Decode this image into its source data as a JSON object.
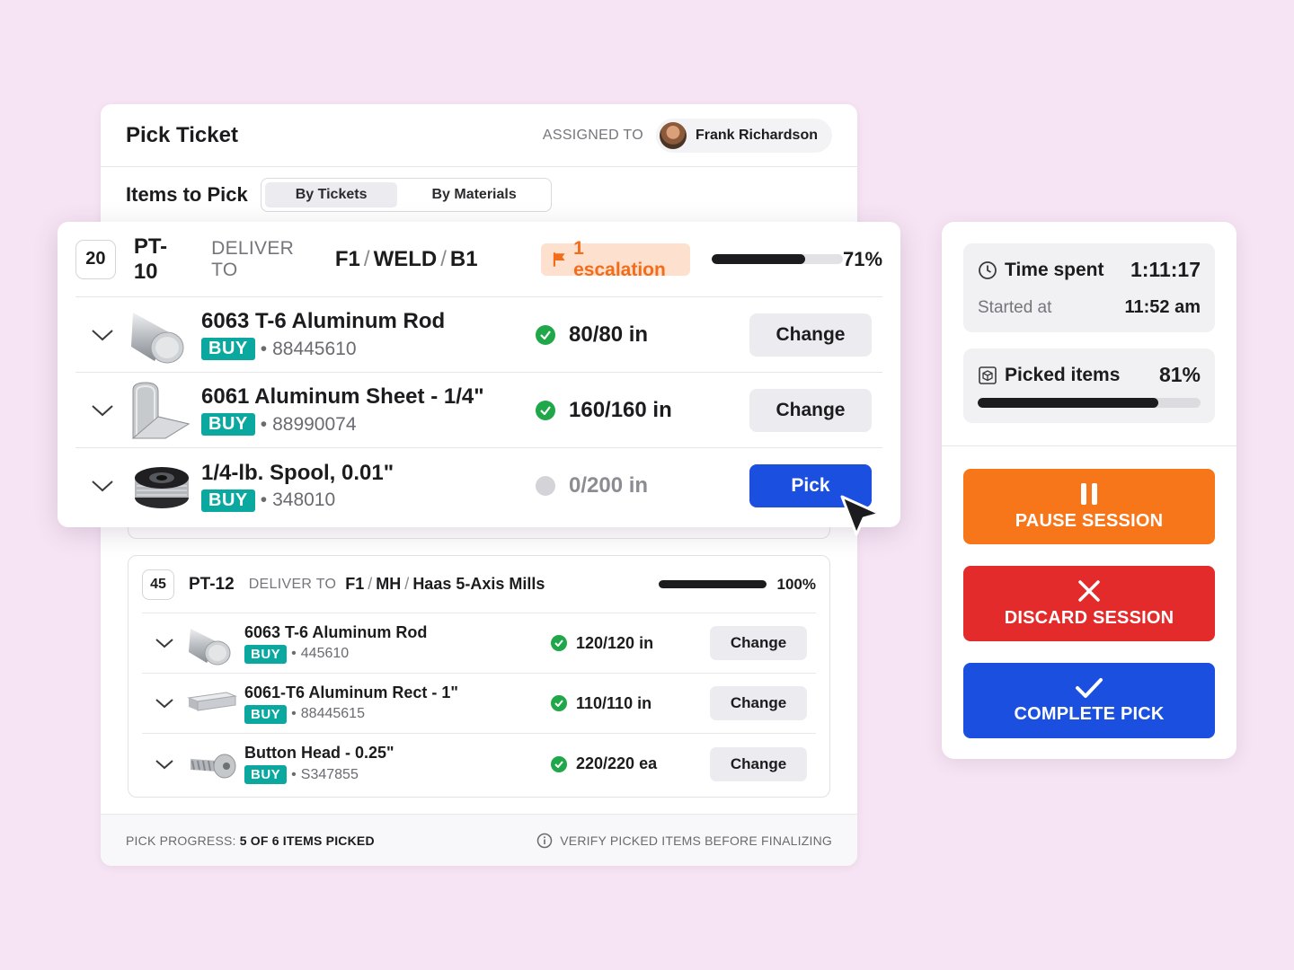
{
  "header": {
    "title": "Pick Ticket",
    "assigned_label": "ASSIGNED TO",
    "assignee": "Frank Richardson"
  },
  "subheader": {
    "title": "Items to Pick",
    "tabs": [
      {
        "label": "By Tickets",
        "active": true
      },
      {
        "label": "By Materials",
        "active": false
      }
    ]
  },
  "tickets": [
    {
      "count": "20",
      "code": "PT-10",
      "deliver_label": "DELIVER TO",
      "location": [
        "F1",
        "WELD",
        "B1"
      ],
      "escalation": "1 escalation",
      "progress": 0.71,
      "progress_label": "71%",
      "items": [
        {
          "name": "6063 T-6 Aluminum Rod",
          "tag": "BUY",
          "sku": "88445610",
          "qty": "80/80 in",
          "status": "picked",
          "action": "Change",
          "icon": "aluminum-rod-icon"
        },
        {
          "name": "6061 Aluminum Sheet - 1/4\"",
          "tag": "BUY",
          "sku": "88990074",
          "qty": "160/160 in",
          "status": "picked",
          "action": "Change",
          "icon": "aluminum-sheet-icon"
        },
        {
          "name": "1/4-lb. Spool, 0.01\"",
          "tag": "BUY",
          "sku": "348010",
          "qty": "0/200 in",
          "status": "pending",
          "action": "Pick",
          "icon": "wire-spool-icon"
        }
      ]
    },
    {
      "count": "45",
      "code": "PT-12",
      "deliver_label": "DELIVER TO",
      "location": [
        "F1",
        "MH",
        "Haas 5-Axis Mills"
      ],
      "progress": 1.0,
      "progress_label": "100%",
      "items": [
        {
          "name": "6063 T-6 Aluminum Rod",
          "tag": "BUY",
          "sku": "445610",
          "qty": "120/120 in",
          "status": "picked",
          "action": "Change",
          "icon": "aluminum-rod-icon"
        },
        {
          "name": "6061-T6 Aluminum Rect - 1\"",
          "tag": "BUY",
          "sku": "88445615",
          "qty": "110/110 in",
          "status": "picked",
          "action": "Change",
          "icon": "aluminum-rect-icon"
        },
        {
          "name": "Button Head - 0.25\"",
          "tag": "BUY",
          "sku": "S347855",
          "qty": "220/220 ea",
          "status": "picked",
          "action": "Change",
          "icon": "button-head-screw-icon"
        }
      ]
    }
  ],
  "footer": {
    "progress_label": "PICK PROGRESS:",
    "progress_value": "5 OF 6 ITEMS PICKED",
    "note": "VERIFY PICKED ITEMS BEFORE FINALIZING"
  },
  "session": {
    "time_spent_label": "Time spent",
    "time_spent": "1:11:17",
    "started_label": "Started at",
    "started_at": "11:52 am",
    "picked_label": "Picked items",
    "picked_pct": "81%",
    "picked_fraction": 0.81,
    "pause_label": "PAUSE SESSION",
    "discard_label": "DISCARD SESSION",
    "complete_label": "COMPLETE PICK"
  },
  "colors": {
    "background": "#f6e4f4",
    "buy_tag": "#0aa89e",
    "primary": "#1a4fe0",
    "pause": "#f7761a",
    "discard": "#e32b2b",
    "success": "#1fa74a",
    "escalation_bg": "#fde0cd",
    "escalation_text": "#f36c1a"
  }
}
